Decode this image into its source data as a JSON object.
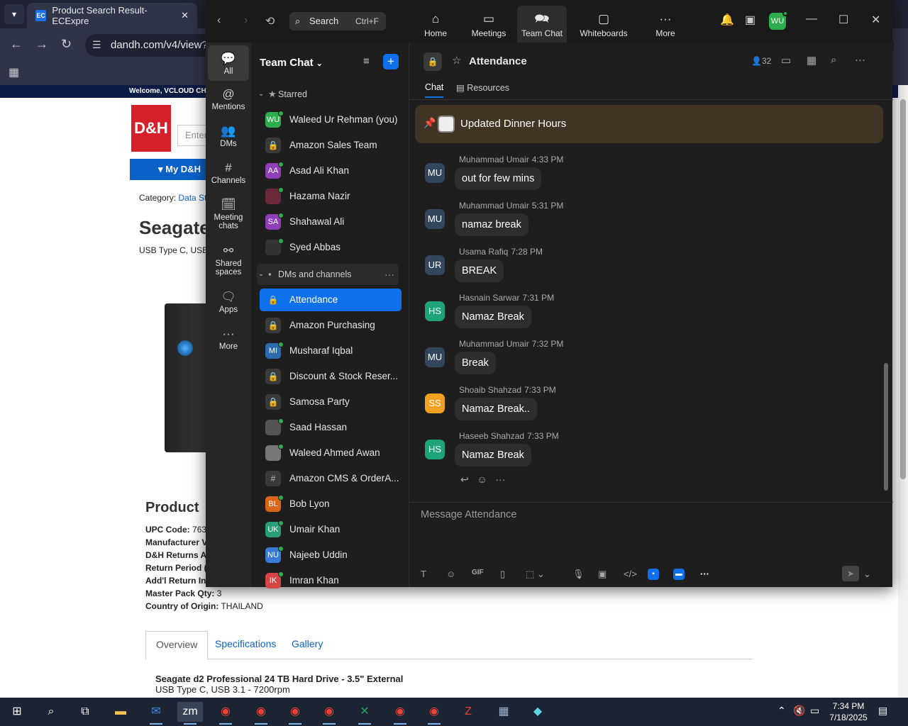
{
  "browser": {
    "tab_title": "Product Search Result- ECExpre",
    "tab_favicon": "EC",
    "url": "dandh.com/v4/view?",
    "welcome": "Welcome, VCLOUD CHO",
    "logo": "D&H",
    "search_placeholder": "Enter",
    "my_dh": "My D&H",
    "category_label": "Category:",
    "category_value": "Data Stor",
    "product_title": "Seagate",
    "product_sub": "USB Type C, USB",
    "section_title": "Product",
    "specs": [
      {
        "label": "UPC Code:",
        "value": "763"
      },
      {
        "label": "Manufacturer V",
        "value": ""
      },
      {
        "label": "D&H Returns A",
        "value": ""
      },
      {
        "label": "Return Period (",
        "value": ""
      },
      {
        "label": "Add'l Return In",
        "value": ""
      },
      {
        "label": "Master Pack Qty:",
        "value": "3"
      },
      {
        "label": "Country of Origin:",
        "value": "THAILAND"
      }
    ],
    "tabs": [
      "Overview",
      "Specifications",
      "Gallery"
    ],
    "desc_title": "Seagate d2 Professional 24 TB Hard Drive - 3.5\" External",
    "desc_sub": "USB Type C, USB 3.1 - 7200rpm"
  },
  "zoom": {
    "search_label": "Search",
    "search_shortcut": "Ctrl+F",
    "top_tabs": [
      {
        "label": "Home",
        "icon": "home-icon"
      },
      {
        "label": "Meetings",
        "icon": "video-icon"
      },
      {
        "label": "Team Chat",
        "icon": "chat-icon"
      },
      {
        "label": "Whiteboards",
        "icon": "whiteboard-icon"
      },
      {
        "label": "More",
        "icon": "more-icon"
      }
    ],
    "user_initials": "WU",
    "rail": [
      {
        "label": "All",
        "icon": "chat-bubble-icon"
      },
      {
        "label": "Mentions",
        "icon": "at-icon"
      },
      {
        "label": "DMs",
        "icon": "people-icon"
      },
      {
        "label": "Channels",
        "icon": "hash-icon"
      },
      {
        "label": "Meeting chats",
        "icon": "calendar-icon"
      },
      {
        "label": "Shared spaces",
        "icon": "share-icon"
      },
      {
        "label": "Apps",
        "icon": "apps-icon"
      },
      {
        "label": "More",
        "icon": "more-icon"
      }
    ],
    "sidebar_title": "Team Chat",
    "starred_label": "Starred",
    "starred": [
      {
        "name": "Waleed Ur Rehman (you)",
        "initials": "WU",
        "color": "#2dad4e",
        "online": true
      },
      {
        "name": "Amazon Sales Team",
        "kind": "lock"
      },
      {
        "name": "Asad Ali Khan",
        "initials": "AA",
        "color": "#8e3fb8",
        "online": true
      },
      {
        "name": "Hazama Nazir",
        "initials": "",
        "color": "#6b2a3a",
        "online": true
      },
      {
        "name": "Shahawal Ali",
        "initials": "SA",
        "color": "#8e3fb8",
        "online": true
      },
      {
        "name": "Syed Abbas",
        "initials": "",
        "color": "#333333",
        "online": true
      }
    ],
    "dms_label": "DMs and channels",
    "dms": [
      {
        "name": "Attendance",
        "kind": "lock",
        "active": true
      },
      {
        "name": "Amazon Purchasing",
        "kind": "lock"
      },
      {
        "name": "Musharaf Iqbal",
        "initials": "MI",
        "color": "#2b6cb0",
        "online": true
      },
      {
        "name": "Discount & Stock Reser...",
        "kind": "lock"
      },
      {
        "name": "Samosa Party",
        "kind": "lock"
      },
      {
        "name": "Saad Hassan",
        "initials": "",
        "color": "#555555",
        "online": true
      },
      {
        "name": "Waleed Ahmed Awan",
        "initials": "",
        "color": "#777777",
        "online": true
      },
      {
        "name": "Amazon CMS & OrderA...",
        "kind": "hash"
      },
      {
        "name": "Bob Lyon",
        "initials": "BL",
        "color": "#d9661a",
        "online": true
      },
      {
        "name": "Umair Khan",
        "initials": "UK",
        "color": "#2a9d7a",
        "online": true
      },
      {
        "name": "Najeeb Uddin",
        "initials": "NU",
        "color": "#3a7bd5",
        "online": true
      },
      {
        "name": "Imran Khan",
        "initials": "IK",
        "color": "#d64545",
        "online": true
      }
    ],
    "channel_title": "Attendance",
    "member_count": "32",
    "channel_tabs": [
      "Chat",
      "Resources"
    ],
    "pinned": "Updated Dinner Hours",
    "messages": [
      {
        "initials": "MU",
        "sender": "Muhammad Umair",
        "time": "4:33 PM",
        "text": "out for few mins",
        "color": "#34465e"
      },
      {
        "initials": "MU",
        "sender": "Muhammad Umair",
        "time": "5:31 PM",
        "text": "namaz break",
        "color": "#34465e"
      },
      {
        "initials": "UR",
        "sender": "Usama Rafiq",
        "time": "7:28 PM",
        "text": "BREAK",
        "color": "#34465e"
      },
      {
        "initials": "HS",
        "sender": "Hasnain Sarwar",
        "time": "7:31 PM",
        "text": "Namaz Break",
        "color": "#1fa37a"
      },
      {
        "initials": "MU",
        "sender": "Muhammad Umair",
        "time": "7:32 PM",
        "text": "Break",
        "color": "#34465e"
      },
      {
        "initials": "SS",
        "sender": "Shoaib Shahzad",
        "time": "7:33 PM",
        "text": "Namaz Break..",
        "color": "#f2a01f"
      },
      {
        "initials": "HS",
        "sender": "Haseeb Shahzad",
        "time": "7:33 PM",
        "text": "Namaz Break",
        "color": "#1fa37a"
      }
    ],
    "composer_placeholder": "Message Attendance"
  },
  "taskbar": {
    "time": "7:34 PM",
    "date": "7/18/2025"
  }
}
